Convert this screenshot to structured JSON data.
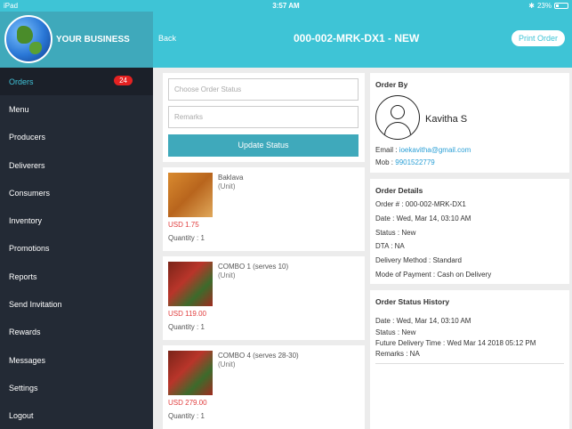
{
  "status_bar": {
    "carrier": "iPad",
    "time": "3:57 AM",
    "battery": "23%"
  },
  "brand": {
    "name": "YOUR BUSINESS"
  },
  "sidebar": {
    "items": [
      {
        "label": "Orders",
        "badge": "24"
      },
      {
        "label": "Menu"
      },
      {
        "label": "Producers"
      },
      {
        "label": "Deliverers"
      },
      {
        "label": "Consumers"
      },
      {
        "label": "Inventory"
      },
      {
        "label": "Promotions"
      },
      {
        "label": "Reports"
      },
      {
        "label": "Send Invitation"
      },
      {
        "label": "Rewards"
      },
      {
        "label": "Messages"
      },
      {
        "label": "Settings"
      },
      {
        "label": "Logout"
      }
    ]
  },
  "header": {
    "back": "Back",
    "title": "000-002-MRK-DX1 - NEW",
    "print": "Print Order"
  },
  "status_form": {
    "status_placeholder": "Choose Order Status",
    "remarks_placeholder": "Remarks",
    "update_label": "Update Status"
  },
  "items": [
    {
      "name": "Baklava",
      "unit": "(Unit)",
      "price": "USD 1.75",
      "qty": "Quantity : 1"
    },
    {
      "name": "COMBO 1 (serves 10)",
      "unit": "(Unit)",
      "price": "USD 119.00",
      "qty": "Quantity : 1"
    },
    {
      "name": "COMBO 4 (serves 28-30)",
      "unit": "(Unit)",
      "price": "USD 279.00",
      "qty": "Quantity : 1"
    }
  ],
  "order_by": {
    "heading": "Order By",
    "name": "Kavitha S",
    "email_label": "Email :",
    "email": "ioekavitha@gmail.com",
    "mob_label": "Mob :",
    "mob": "9901522779"
  },
  "order_details": {
    "heading": "Order Details",
    "lines": [
      "Order # : 000-002-MRK-DX1",
      "Date : Wed, Mar 14, 03:10 AM",
      "Status : New",
      "DTA :  NA",
      "Delivery Method : Standard",
      "Mode of Payment : Cash on Delivery"
    ]
  },
  "status_history": {
    "heading": "Order Status History",
    "lines": [
      "Date : Wed, Mar 14, 03:10 AM",
      "Status : New",
      "Future Delivery Time : Wed Mar 14 2018 05:12 PM",
      "Remarks : NA"
    ]
  }
}
